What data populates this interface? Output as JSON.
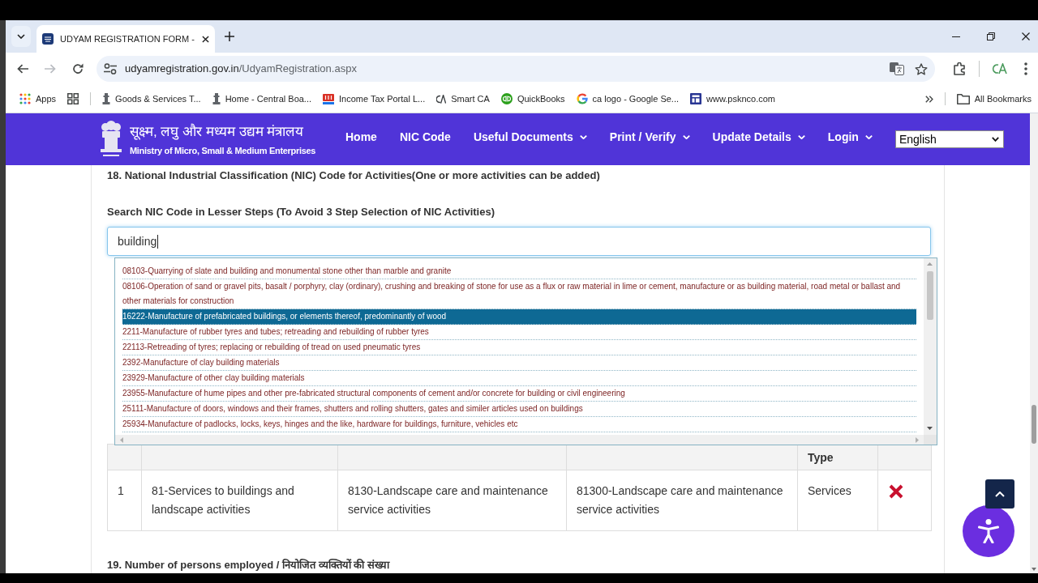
{
  "browser": {
    "tabs": [
      {
        "title": "UDYAM REGISTRATION FORM -",
        "selected": true
      }
    ],
    "history_buttons": [
      {
        "kind": "back",
        "disabled": false
      },
      {
        "kind": "forward",
        "disabled": true
      }
    ],
    "url": {
      "host": "udyamregistration.gov.in",
      "path": "/UdyamRegistration.aspx"
    },
    "bookmarks": [
      {
        "kind": "apps",
        "label": "Apps"
      },
      {
        "kind": "tab-groups"
      },
      {
        "kind": "emblem",
        "label": "Goods & Services T..."
      },
      {
        "kind": "emblem",
        "label": "Home - Central Boa..."
      },
      {
        "kind": "building",
        "label": "Income Tax Portal L..."
      },
      {
        "kind": "monogram",
        "label": "Smart CA"
      },
      {
        "kind": "round-logo",
        "label": "QuickBooks"
      },
      {
        "kind": "google",
        "label": "ca logo - Google Se..."
      },
      {
        "kind": "layout",
        "label": "www.psknco.com"
      }
    ],
    "all_bookmarks": "All Bookmarks"
  },
  "site_header": {
    "ministry_hindi": "सूक्ष्म, लघु और मध्यम उद्यम मंत्रालय",
    "ministry_english": "Ministry of Micro, Small & Medium Enterprises",
    "nav": [
      {
        "label": "Home",
        "has_menu": false
      },
      {
        "label": "NIC Code",
        "has_menu": false
      },
      {
        "label": "Useful Documents",
        "has_menu": true
      },
      {
        "label": "Print / Verify",
        "has_menu": true
      },
      {
        "label": "Update Details",
        "has_menu": true
      },
      {
        "label": "Login",
        "has_menu": true
      }
    ],
    "language": "English"
  },
  "form": {
    "section_18": "18. National Industrial Classification (NIC) Code for Activities(One or more activities can be added)",
    "search_label": "Search NIC Code in Lesser Steps (To Avoid 3 Step Selection of NIC Activities)",
    "search": {
      "value": "building",
      "focused": true
    },
    "suggestions": [
      {
        "text": "08103-Quarrying of slate and building and monumental stone other than marble and granite",
        "selected": false
      },
      {
        "text": "08106-Operation of sand or gravel pits, basalt / porphyry, clay (ordinary), crushing and breaking of stone for use as a flux or raw material in lime or cement, manufacture or as building material, road metal or ballast and other materials for construction",
        "selected": false
      },
      {
        "text": "16222-Manufacture of prefabricated buildings, or elements thereof, predominantly of wood",
        "selected": true
      },
      {
        "text": "2211-Manufacture of rubber tyres and tubes; retreading and rebuilding of rubber tyres",
        "selected": false
      },
      {
        "text": "22113-Retreading of tyres; replacing or rebuilding of tread on used pneumatic tyres",
        "selected": false
      },
      {
        "text": "2392-Manufacture of clay building materials",
        "selected": false
      },
      {
        "text": "23929-Manufacture of other clay building materials",
        "selected": false
      },
      {
        "text": "23955-Manufacture of hume pipes and other pre-fabricated structural components of cement and/or concrete for building or civil engineering",
        "selected": false
      },
      {
        "text": "25111-Manufacture of doors, windows and their frames, shutters and rolling shutters, gates and similer articles used on buildings",
        "selected": false
      },
      {
        "text": "25934-Manufacture of padlocks, locks, keys, hinges and the like, hardware for buildings, furniture, vehicles etc",
        "selected": false
      }
    ],
    "activities_table": {
      "type_heading": "Type",
      "rows": [
        {
          "serial": "1",
          "column_2": "81-Services to buildings and landscape activities",
          "column_3": "8130-Landscape care and maintenance service activities",
          "column_4": "81300-Landscape care and maintenance service activities",
          "type": "Services"
        }
      ]
    },
    "section_19": "19. Number of persons employed / नियोजित व्यक्तियों की संख्या"
  }
}
